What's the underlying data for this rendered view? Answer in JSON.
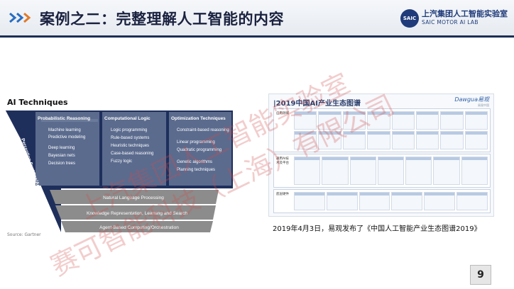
{
  "header": {
    "title": "案例之二：完整理解人工智能的内容",
    "brand_cn": "上汽集团人工智能实验室",
    "brand_en": "SAIC MOTOR AI LAB",
    "brand_logo": "SAIC"
  },
  "left_panel": {
    "title": "AI Techniques",
    "columns": [
      {
        "heading": "Probabilistic Reasoning",
        "items": [
          "Machine learning",
          "Predictive modeling",
          "Deep learning",
          "Bayesian nets",
          "Decision trees"
        ]
      },
      {
        "heading": "Computational Logic",
        "items": [
          "Logic programming",
          "Rule-based systems",
          "Heuristic techniques",
          "Case-based reasoning",
          "Fuzzy logic"
        ]
      },
      {
        "heading": "Optimization Techniques",
        "items": [
          "Constraint-based reasoning",
          "Linear programming",
          "Quadratic programming",
          "Genetic algorithms",
          "Planning techniques"
        ]
      }
    ],
    "side_label": "Perception Systems/Ambient Intelligence",
    "bands": [
      "Natural Language Processing",
      "Knowledge Representation, Learning and Search",
      "Agent-Based Computing/Orchestration"
    ],
    "source": "Source: Gartner"
  },
  "right_panel": {
    "title": "|2019中国AI产业生态图谱",
    "brand": "Dawgua易观",
    "brand_sub": "易观中国",
    "sections": [
      "应用领域",
      "通用AI技术及平台",
      "底层硬件"
    ],
    "caption": "2019年4月3日，易观发布了《中国人工智能产业生态图谱2019》"
  },
  "watermark": {
    "line1": "上汽集团人工智能实验室",
    "line2": "赛可智能科技（上海）有限公司"
  },
  "page_number": "9",
  "colors": {
    "header_bar": "#1c2e56",
    "funnel_dark": "#1f2f5c",
    "band_gray": "#8c8c8c",
    "watermark": "#d04a4a"
  }
}
